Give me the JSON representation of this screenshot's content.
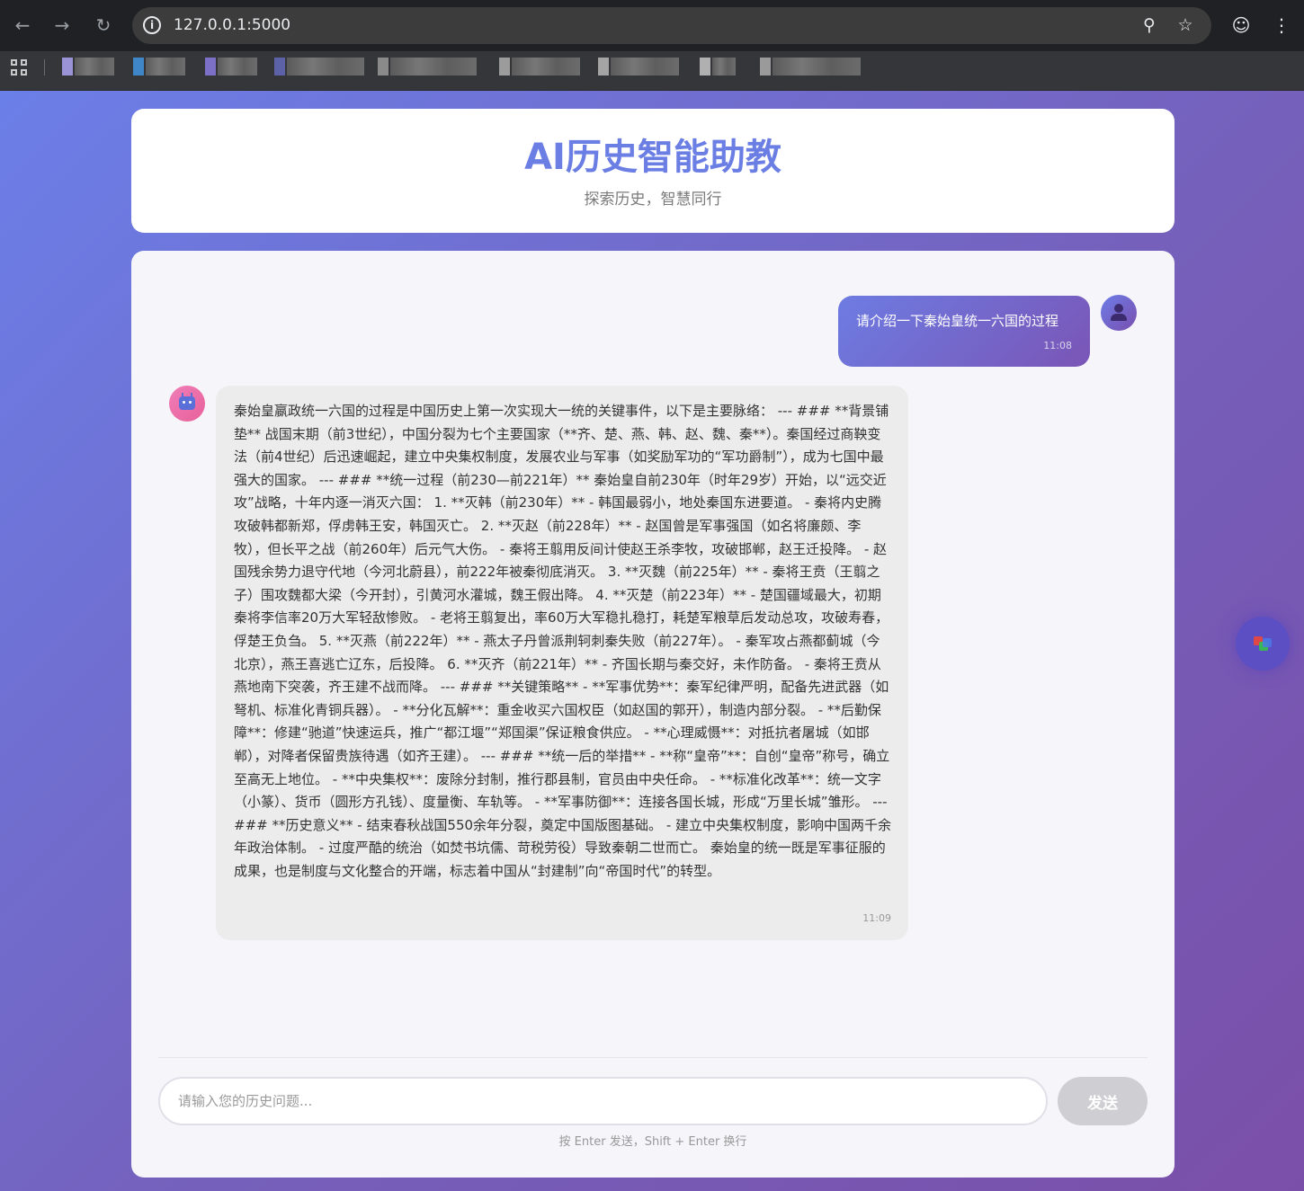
{
  "browser": {
    "url": "127.0.0.1:5000",
    "bookmark_colors": [
      "#9a93d6",
      "#3f86c9",
      "#7b6fc6",
      "#5d62a8",
      "#8a8a8a",
      "#9c9c9c",
      "#a4a4a4",
      "#b0b0b0",
      "#9a9a9a",
      "#a8a8a8"
    ]
  },
  "header": {
    "title": "AI历史智能助教",
    "subtitle": "探索历史，智慧同行"
  },
  "chat": {
    "messages": [
      {
        "role": "user",
        "text": "请介绍一下秦始皇统一六国的过程",
        "time": "11:08"
      },
      {
        "role": "assistant",
        "text": "秦始皇嬴政统一六国的过程是中国历史上第一次实现大一统的关键事件，以下是主要脉络： --- ### **背景铺垫** 战国末期（前3世纪），中国分裂为七个主要国家（**齐、楚、燕、韩、赵、魏、秦**）。秦国经过商鞅变法（前4世纪）后迅速崛起，建立中央集权制度，发展农业与军事（如奖励军功的“军功爵制”），成为七国中最强大的国家。 --- ### **统一过程（前230—前221年）** 秦始皇自前230年（时年29岁）开始，以“远交近攻”战略，十年内逐一消灭六国： 1. **灭韩（前230年）** - 韩国最弱小，地处秦国东进要道。 - 秦将内史腾攻破韩都新郑，俘虏韩王安，韩国灭亡。 2. **灭赵（前228年）** - 赵国曾是军事强国（如名将廉颇、李牧），但长平之战（前260年）后元气大伤。 - 秦将王翦用反间计使赵王杀李牧，攻破邯郸，赵王迁投降。 - 赵国残余势力退守代地（今河北蔚县），前222年被秦彻底消灭。 3. **灭魏（前225年）** - 秦将王贲（王翦之子）围攻魏都大梁（今开封），引黄河水灌城，魏王假出降。 4. **灭楚（前223年）** - 楚国疆域最大，初期秦将李信率20万大军轻敌惨败。 - 老将王翦复出，率60万大军稳扎稳打，耗楚军粮草后发动总攻，攻破寿春，俘楚王负刍。 5. **灭燕（前222年）** - 燕太子丹曾派荆轲刺秦失败（前227年）。 - 秦军攻占燕都蓟城（今北京），燕王喜逃亡辽东，后投降。 6. **灭齐（前221年）** - 齐国长期与秦交好，未作防备。 - 秦将王贲从燕地南下突袭，齐王建不战而降。 --- ### **关键策略** - **军事优势**：秦军纪律严明，配备先进武器（如弩机、标准化青铜兵器）。 - **分化瓦解**：重金收买六国权臣（如赵国的郭开），制造内部分裂。 - **后勤保障**：修建“驰道”快速运兵，推广“都江堰”“郑国渠”保证粮食供应。 - **心理威慑**：对抵抗者屠城（如邯郸），对降者保留贵族待遇（如齐王建）。 --- ### **统一后的举措** - **称“皇帝”**：自创“皇帝”称号，确立至高无上地位。 - **中央集权**：废除分封制，推行郡县制，官员由中央任命。 - **标准化改革**：统一文字（小篆）、货币（圆形方孔钱）、度量衡、车轨等。 - **军事防御**：连接各国长城，形成“万里长城”雏形。 --- ### **历史意义** - 结束春秋战国550余年分裂，奠定中国版图基础。 - 建立中央集权制度，影响中国两千余年政治体制。 - 过度严酷的统治（如焚书坑儒、苛税劳役）导致秦朝二世而亡。 秦始皇的统一既是军事征服的成果，也是制度与文化整合的开端，标志着中国从“封建制”向“帝国时代”的转型。",
        "time": "11:09"
      }
    ],
    "input_placeholder": "请输入您的历史问题...",
    "send_label": "发送",
    "hint": "按 Enter 发送，Shift + Enter 换行"
  }
}
